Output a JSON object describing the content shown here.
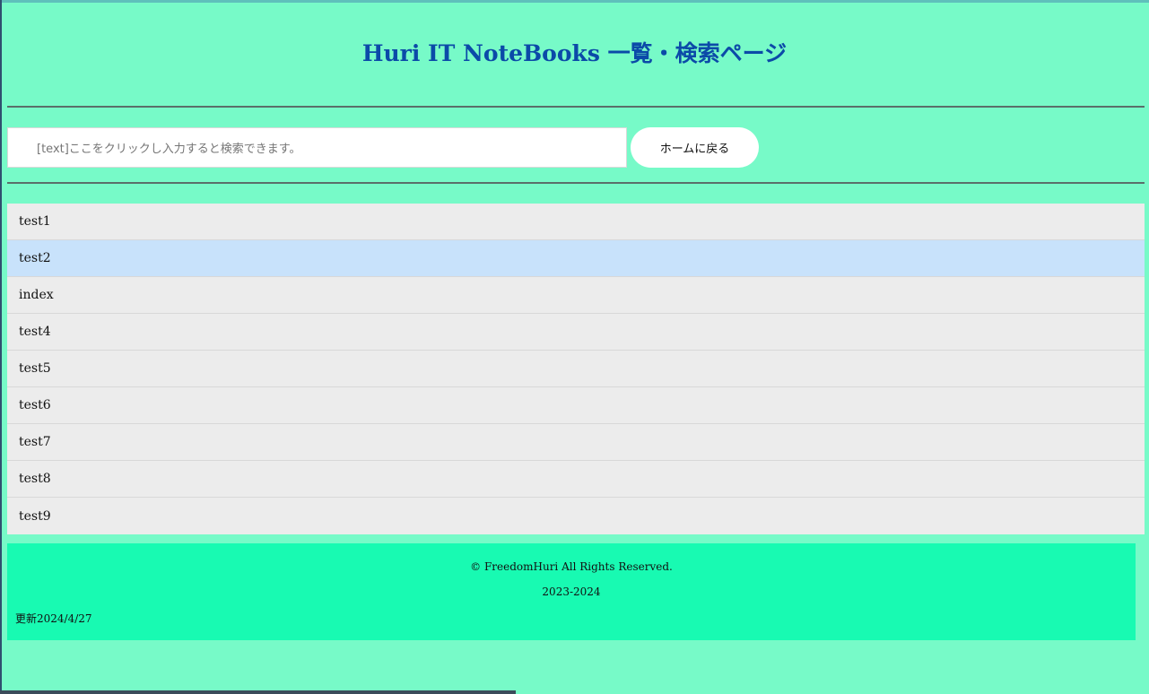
{
  "header": {
    "title": "Huri IT NoteBooks 一覧・検索ページ"
  },
  "search": {
    "placeholder": "[text]ここをクリックし入力すると検索できます。"
  },
  "buttons": {
    "home_label": "ホームに戻る"
  },
  "list": {
    "items": [
      "test1",
      "test2",
      "index",
      "test4",
      "test5",
      "test6",
      "test7",
      "test8",
      "test9"
    ],
    "selected_index": 1
  },
  "footer": {
    "copyright": "© FreedomHuri All Rights Reserved.",
    "years": "2023-2024",
    "updated": "更新2024/4/27"
  },
  "colors": {
    "page_bg": "#77fac8",
    "title": "#0b4aa8",
    "footer_bg": "#18fab2",
    "list_item_bg": "#ececec",
    "list_item_selected_bg": "#c8e2fb"
  }
}
